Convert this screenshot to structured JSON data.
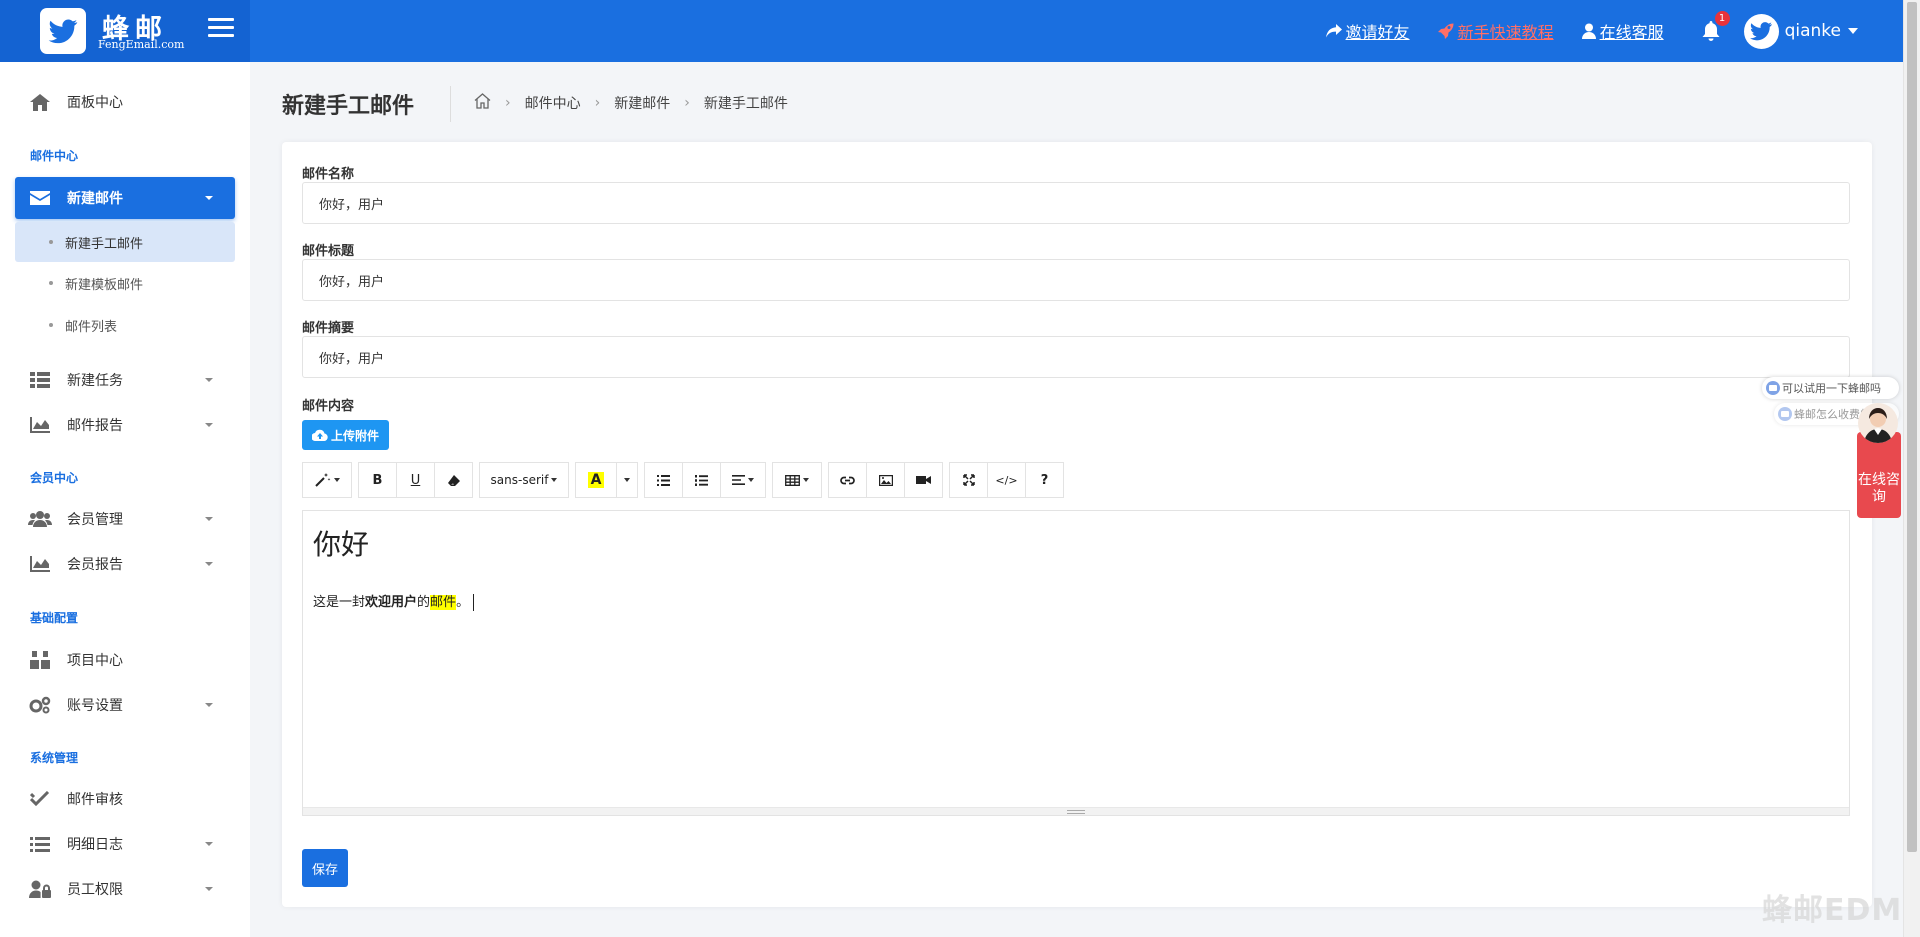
{
  "brand": {
    "name": "蜂邮",
    "sub": "FengEmail.com"
  },
  "header": {
    "links": [
      {
        "label": "邀请好友",
        "icon": "share-icon"
      },
      {
        "label": "新手快速教程",
        "icon": "rocket-icon"
      },
      {
        "label": "在线客服",
        "icon": "user-icon"
      }
    ],
    "notification_count": "1",
    "username": "qianke"
  },
  "sidebar": {
    "dashboard": "面板中心",
    "section_mail": "邮件中心",
    "new_mail": "新建邮件",
    "sub_manual": "新建手工邮件",
    "sub_template": "新建模板邮件",
    "sub_list": "邮件列表",
    "new_task": "新建任务",
    "mail_report": "邮件报告",
    "section_member": "会员中心",
    "member_manage": "会员管理",
    "member_report": "会员报告",
    "section_base": "基础配置",
    "project_center": "项目中心",
    "account_settings": "账号设置",
    "section_system": "系统管理",
    "mail_review": "邮件审核",
    "detail_log": "明细日志",
    "staff_perm": "员工权限"
  },
  "page": {
    "title": "新建手工邮件",
    "breadcrumb": [
      "邮件中心",
      "新建邮件",
      "新建手工邮件"
    ]
  },
  "form": {
    "name_label": "邮件名称",
    "name_value": "你好，用户",
    "subject_label": "邮件标题",
    "subject_value": "你好，用户",
    "summary_label": "邮件摘要",
    "summary_value": "你好，用户",
    "content_label": "邮件内容",
    "upload_label": "上传附件",
    "font_name": "sans-serif",
    "editor_heading": "你好",
    "editor_text_1": "这是一封",
    "editor_text_bold": "欢迎用户",
    "editor_text_2": "的",
    "editor_text_hl": "邮件",
    "editor_text_3": "。",
    "save_label": "保存",
    "highlight_color": "#ffff00"
  },
  "chat": {
    "bubble_1": "可以试用一下蜂邮吗",
    "bubble_2": "蜂邮怎么收费的呢",
    "widget_label": "在线咨询"
  },
  "watermark": "蜂邮EDM"
}
